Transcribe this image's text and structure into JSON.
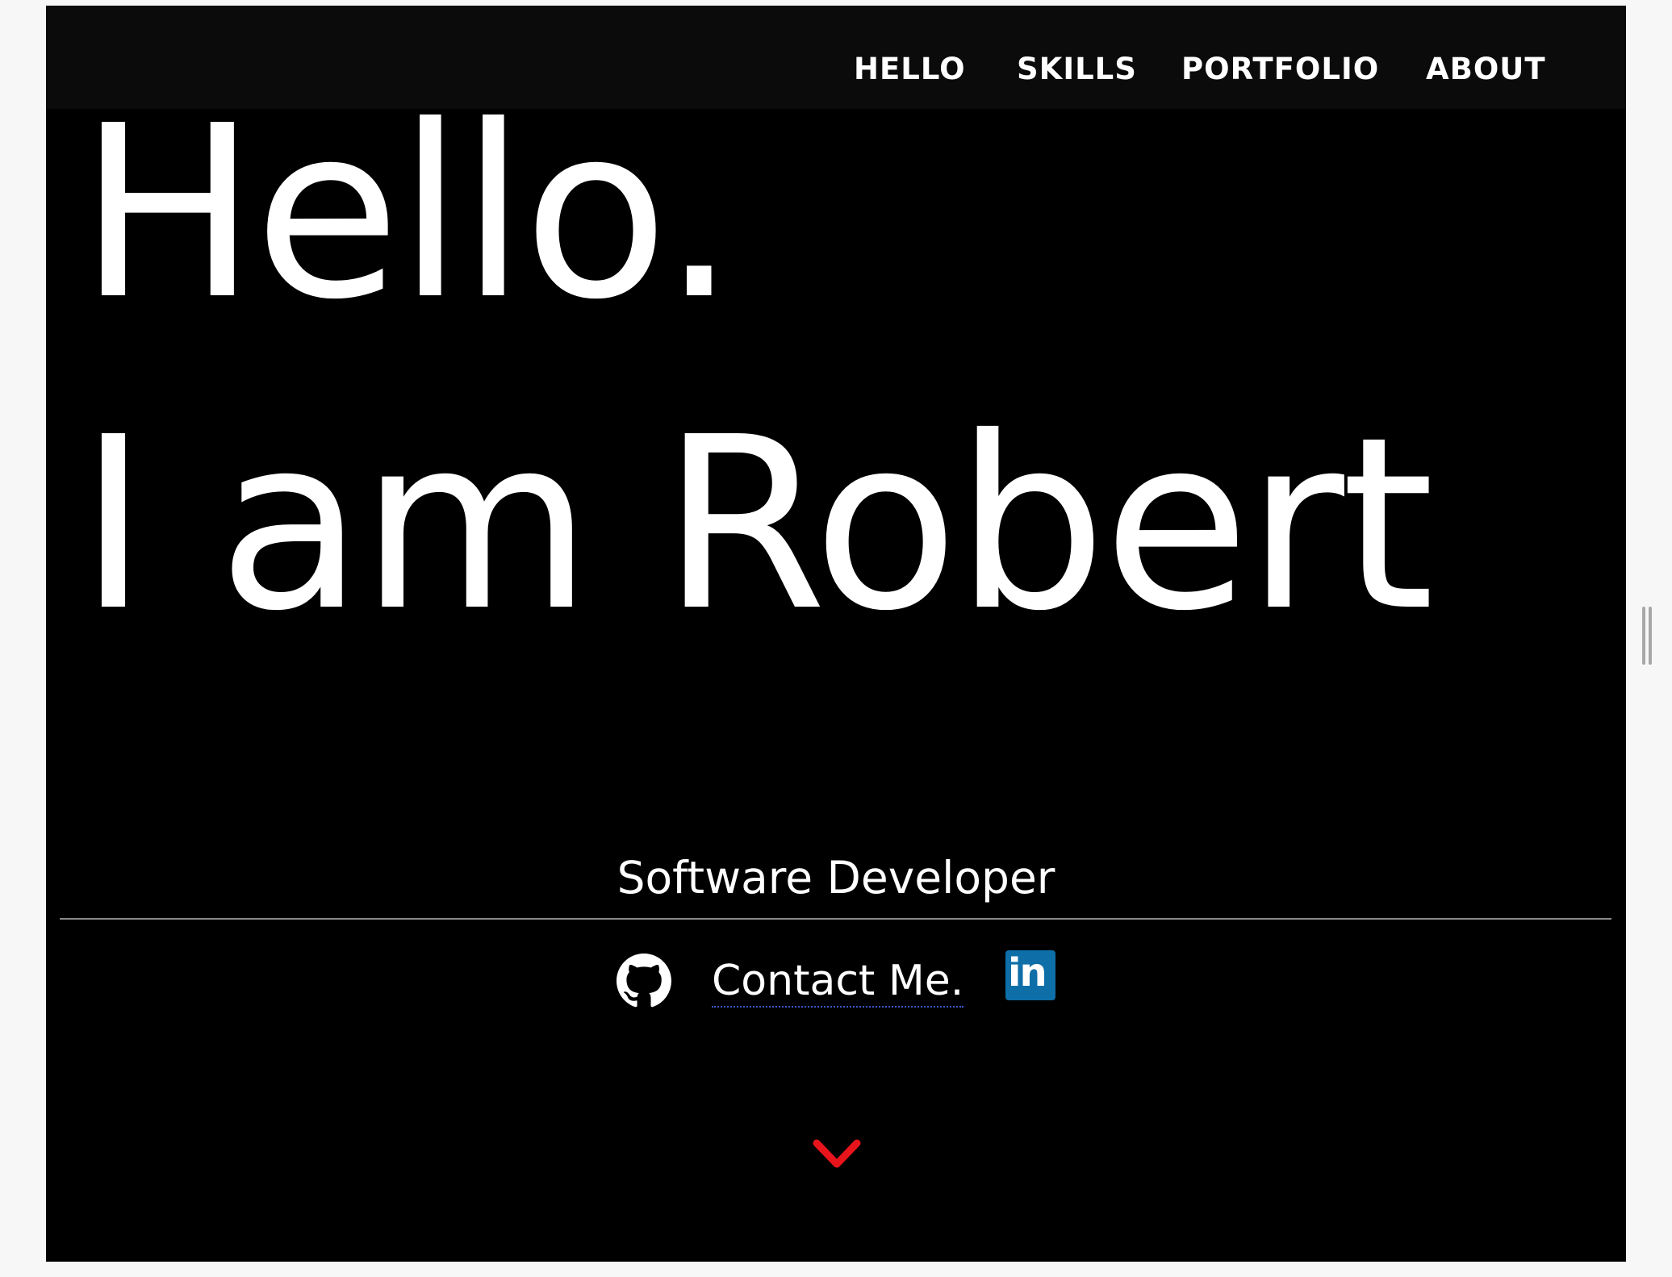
{
  "nav": {
    "items": [
      {
        "label": "HELLO"
      },
      {
        "label": "SKILLS"
      },
      {
        "label": "PORTFOLIO"
      },
      {
        "label": "ABOUT"
      }
    ]
  },
  "hero": {
    "greeting": "Hello.",
    "intro": "I am Robert",
    "subtitle": "Software Developer"
  },
  "contact": {
    "label": "Contact Me.",
    "icons": [
      "github-icon",
      "linkedin-icon"
    ],
    "linkedin_text": "in"
  },
  "scroll": {
    "icon": "chevron-down-icon"
  },
  "colors": {
    "background": "#000000",
    "navbar": "#0b0b0b",
    "text": "#ffffff",
    "divider": "#8a8a8a",
    "link_underline": "#3a57c8",
    "linkedin_blue": "#0e6ea8",
    "accent_red": "#e8141b"
  }
}
